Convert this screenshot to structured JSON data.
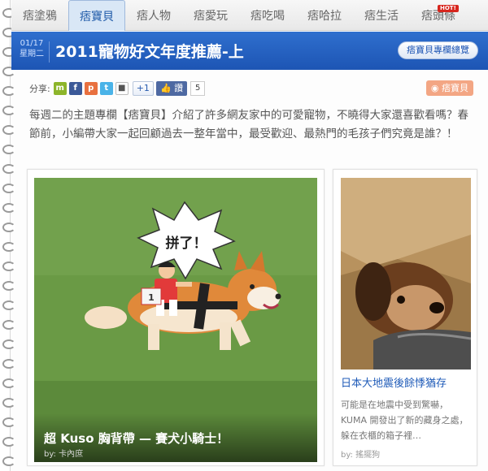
{
  "nav": {
    "tabs": [
      {
        "label": "痞塗鴉",
        "active": false
      },
      {
        "label": "痞寶貝",
        "active": true
      },
      {
        "label": "痞人物",
        "active": false
      },
      {
        "label": "痞愛玩",
        "active": false
      },
      {
        "label": "痞吃喝",
        "active": false
      },
      {
        "label": "痞哈拉",
        "active": false
      },
      {
        "label": "痞生活",
        "active": false
      },
      {
        "label": "痞頭條",
        "active": false
      }
    ],
    "hot_badge": "HOT!"
  },
  "header": {
    "date": "01/17",
    "weekday": "星期二",
    "title": "2011寵物好文年度推薦-上",
    "overview_button": "痞寶貝專欄總覽",
    "accent_color": "#1d55b4"
  },
  "share": {
    "label": "分享:",
    "icons": [
      {
        "name": "plurk-icon",
        "glyph": "m",
        "color": "#8db52b"
      },
      {
        "name": "facebook-icon",
        "glyph": "f",
        "color": "#3b5998"
      },
      {
        "name": "plurk-orange-icon",
        "glyph": "p",
        "color": "#e8703f"
      },
      {
        "name": "twitter-icon",
        "glyph": "t",
        "color": "#4ab3e8"
      },
      {
        "name": "bookmark-icon",
        "glyph": "■",
        "color": "#555555"
      }
    ],
    "plus_one": "+1",
    "like_label": "讚",
    "like_count": "5",
    "rss_label": "痞寶貝",
    "rss_color": "#f3a684"
  },
  "intro": "每週二的主題專欄【痞寶貝】介紹了許多網友家中的可愛寵物，不曉得大家還喜歡看嗎？春節前，小編帶大家一起回顧過去一整年當中，最受歡迎、最熱門的毛孩子們究竟是誰？！",
  "featured": {
    "bubble_text": "拼了！",
    "title": "超 Kuso 胸背帶 — 賽犬小騎士！",
    "author": "by: 卡內庶"
  },
  "side_article": {
    "title": "日本大地震後餘悸猶存",
    "summary": "可能是在地震中受到驚嚇，KUMA 開發出了新的藏身之處，躲在衣櫃的箱子裡…",
    "author": "by: 搖擺狗"
  }
}
